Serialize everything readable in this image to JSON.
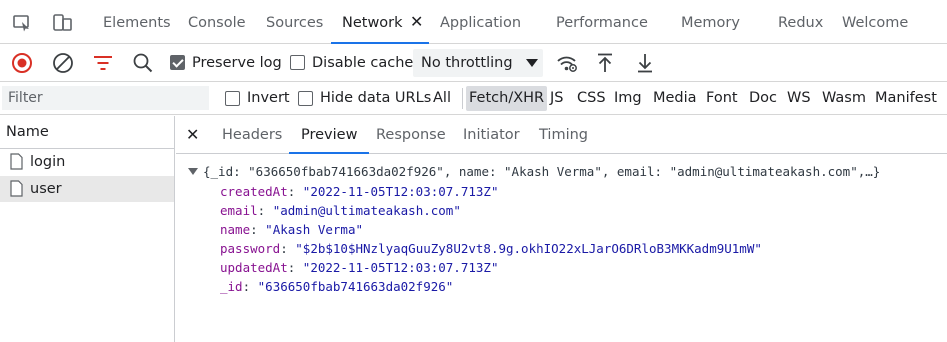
{
  "devtools": {
    "tabs": [
      {
        "label": "Elements"
      },
      {
        "label": "Console"
      },
      {
        "label": "Sources"
      },
      {
        "label": "Network",
        "active": true
      },
      {
        "label": "Application"
      },
      {
        "label": "Performance"
      },
      {
        "label": "Memory"
      },
      {
        "label": "Redux"
      },
      {
        "label": "Welcome"
      }
    ],
    "tab_close_symbol": "✕",
    "icons": {
      "inspect": "inspect-element-icon",
      "device": "device-toolbar-icon"
    }
  },
  "toolbar": {
    "record_icon": "record-stop-icon",
    "clear_icon": "clear-icon",
    "filter_icon": "filter-icon",
    "search_icon": "search-icon",
    "preserve_log": {
      "label": "Preserve log",
      "checked": true
    },
    "disable_cache": {
      "label": "Disable cache",
      "checked": false
    },
    "throttling": {
      "value": "No throttling"
    },
    "conditions_icon": "network-conditions-icon",
    "import_icon": "import-har-icon",
    "export_icon": "export-har-icon"
  },
  "filterbar": {
    "placeholder": "Filter",
    "invert": {
      "label": "Invert",
      "checked": false
    },
    "hide_data_urls": {
      "label": "Hide data URLs",
      "checked": false
    },
    "types": [
      {
        "label": "All"
      },
      {
        "label": "Fetch/XHR",
        "active": true
      },
      {
        "label": "JS"
      },
      {
        "label": "CSS"
      },
      {
        "label": "Img"
      },
      {
        "label": "Media"
      },
      {
        "label": "Font"
      },
      {
        "label": "Doc"
      },
      {
        "label": "WS"
      },
      {
        "label": "Wasm"
      },
      {
        "label": "Manifest"
      }
    ]
  },
  "requests": {
    "header": "Name",
    "items": [
      {
        "name": "login",
        "icon": "document-icon"
      },
      {
        "name": "user",
        "icon": "document-icon",
        "selected": true
      }
    ]
  },
  "detail": {
    "close_symbol": "✕",
    "tabs": [
      {
        "label": "Headers"
      },
      {
        "label": "Preview",
        "active": true
      },
      {
        "label": "Response"
      },
      {
        "label": "Initiator"
      },
      {
        "label": "Timing"
      }
    ],
    "preview": {
      "summary": "{_id: \"636650fbab741663da02f926\", name: \"Akash Verma\", email: \"admin@ultimateakash.com\",…}",
      "properties": [
        {
          "key": "createdAt",
          "value": "\"2022-11-05T12:03:07.713Z\""
        },
        {
          "key": "email",
          "value": "\"admin@ultimateakash.com\""
        },
        {
          "key": "name",
          "value": "\"Akash Verma\""
        },
        {
          "key": "password",
          "value": "\"$2b$10$HNzlyaqGuuZy8U2vt8.9g.okhIO22xLJarO6DRloB3MKKadm9U1mW\""
        },
        {
          "key": "updatedAt",
          "value": "\"2022-11-05T12:03:07.713Z\""
        },
        {
          "key": "_id",
          "value": "\"636650fbab741663da02f926\""
        }
      ]
    }
  },
  "colors": {
    "accent": "#1a73e8",
    "record": "#d93025",
    "filter_active": "#d93025",
    "json_key": "#881391",
    "json_string": "#1a1aa6"
  }
}
